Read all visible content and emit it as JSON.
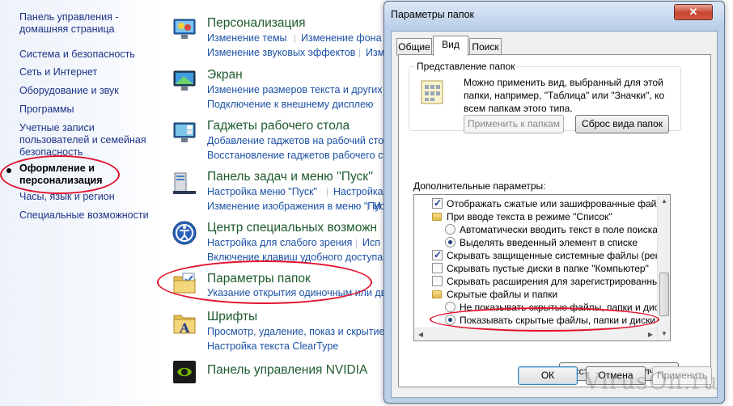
{
  "leftnav": {
    "home": "Панель управления - домашняя страница",
    "items": [
      "Система и безопасность",
      "Сеть и Интернет",
      "Оборудование и звук",
      "Программы",
      "Учетные записи пользователей и семейная безопасность",
      "Оформление и персонализация",
      "Часы, язык и регион",
      "Специальные возможности"
    ]
  },
  "categories": [
    {
      "title": "Персонализация",
      "icon": "personalization-icon",
      "links": [
        "Изменение темы",
        "Изменение фона р",
        "Изменение звуковых эффектов",
        "Измен"
      ]
    },
    {
      "title": "Экран",
      "icon": "display-icon",
      "links": [
        "Изменение размеров текста и других эл",
        "Подключение к внешнему дисплею"
      ]
    },
    {
      "title": "Гаджеты рабочего стола",
      "icon": "gadgets-icon",
      "links": [
        "Добавление гаджетов на рабочий стол",
        "Восстановление гаджетов рабочего стол"
      ]
    },
    {
      "title": "Панель задач и меню ''Пуск''",
      "icon": "taskbar-icon",
      "links": [
        "Настройка меню \"Пуск\"",
        "Настройка",
        "Изменение изображения в меню \"Пуск\"",
        "И"
      ]
    },
    {
      "title": "Центр специальных возможн",
      "icon": "ease-of-access-icon",
      "links": [
        "Настройка для слабого зрения",
        "Исп",
        "Включение клавиш удобного доступа"
      ]
    },
    {
      "title": "Параметры папок",
      "icon": "folder-options-icon",
      "links": [
        "Указание открытия одиночным или двой"
      ]
    },
    {
      "title": "Шрифты",
      "icon": "fonts-icon",
      "links": [
        "Просмотр, удаление, показ и скрытие ш",
        "Настройка текста ClearType"
      ]
    },
    {
      "title": "Панель управления NVIDIA",
      "icon": "nvidia-icon",
      "links": []
    }
  ],
  "dialog": {
    "title": "Параметры папок",
    "close": "✕",
    "tabs": [
      "Общие",
      "Вид",
      "Поиск"
    ],
    "folder_view": {
      "legend": "Представление папок",
      "text": "Можно применить вид, выбранный для этой папки, например, \"Таблица\" или \"Значки\", ко всем папкам этого типа.",
      "apply_button": "Применить к папкам",
      "reset_button": "Сброс вида папок"
    },
    "advanced_label": "Дополнительные параметры:",
    "options": [
      {
        "type": "checkbox",
        "checked": true,
        "indent": 1,
        "label": "Отображать сжатые или зашифрованные файлы NTFS"
      },
      {
        "type": "folder",
        "indent": 1,
        "label": "При вводе текста в режиме \"Список\""
      },
      {
        "type": "radio",
        "checked": false,
        "indent": 2,
        "label": "Автоматически вводить текст в поле поиска"
      },
      {
        "type": "radio",
        "checked": true,
        "indent": 2,
        "label": "Выделять введенный элемент в списке"
      },
      {
        "type": "checkbox",
        "checked": true,
        "indent": 1,
        "label": "Скрывать защищенные системные файлы (рекомен"
      },
      {
        "type": "checkbox",
        "checked": false,
        "indent": 1,
        "label": "Скрывать пустые диски в папке \"Компьютер\""
      },
      {
        "type": "checkbox",
        "checked": false,
        "indent": 1,
        "label": "Скрывать расширения для зарегистрированных типо"
      },
      {
        "type": "folder",
        "indent": 1,
        "label": "Скрытые файлы и папки"
      },
      {
        "type": "radio",
        "checked": false,
        "indent": 2,
        "label": "Не показывать скрытые файлы, папки и диски"
      },
      {
        "type": "radio",
        "checked": true,
        "indent": 2,
        "label": "Показывать скрытые файлы, папки и диски"
      }
    ],
    "restore_button": "Восстановить умолчания",
    "ok": "ОК",
    "cancel": "Отмена",
    "apply": "Применить"
  },
  "watermark": "VirusOn.ru",
  "colors": {
    "highlight": "#e3132f",
    "link": "#1c51a6",
    "title": "#1e5a2e"
  }
}
